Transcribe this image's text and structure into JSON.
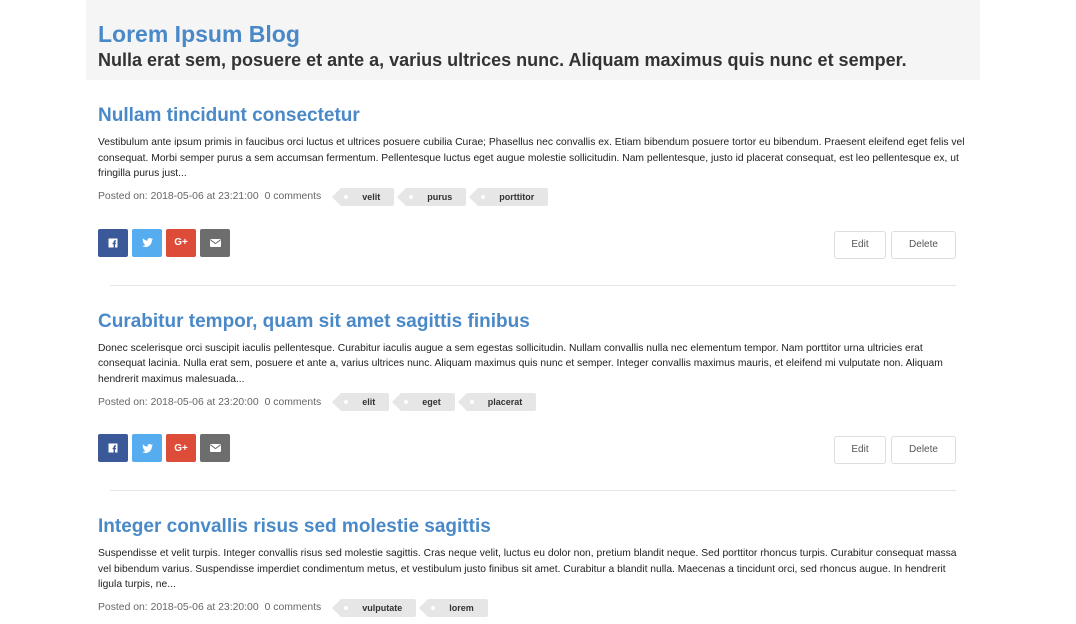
{
  "header": {
    "title": "Lorem Ipsum Blog",
    "subtitle": "Nulla erat sem, posuere et ante a, varius ultrices nunc. Aliquam maximus quis nunc et semper."
  },
  "posts": [
    {
      "title": "Nullam tincidunt consectetur",
      "excerpt": "Vestibulum ante ipsum primis in faucibus orci luctus et ultrices posuere cubilia Curae; Phasellus nec convallis ex. Etiam bibendum posuere tortor eu bibendum. Praesent eleifend eget felis vel consequat. Morbi semper purus a sem accumsan fermentum. Pellentesque luctus eget augue molestie sollicitudin. Nam pellentesque, justo id placerat consequat, est leo pellentesque ex, ut fringilla purus just...",
      "posted": "Posted on: 2018-05-06 at 23:21:00",
      "comments": "0 comments",
      "tags": [
        "velit",
        "purus",
        "porttitor"
      ],
      "edit_label": "Edit",
      "delete_label": "Delete"
    },
    {
      "title": "Curabitur tempor, quam sit amet sagittis finibus",
      "excerpt": "Donec scelerisque orci suscipit iaculis pellentesque. Curabitur iaculis augue a sem egestas sollicitudin. Nullam convallis nulla nec elementum tempor. Nam porttitor urna ultricies erat consequat lacinia. Nulla erat sem, posuere et ante a, varius ultrices nunc. Aliquam maximus quis nunc et semper. Integer convallis maximus mauris, et eleifend mi vulputate non. Aliquam hendrerit maximus malesuada...",
      "posted": "Posted on: 2018-05-06 at 23:20:00",
      "comments": "0 comments",
      "tags": [
        "elit",
        "eget",
        "placerat"
      ],
      "edit_label": "Edit",
      "delete_label": "Delete"
    },
    {
      "title": "Integer convallis risus sed molestie sagittis",
      "excerpt": "Suspendisse et velit turpis. Integer convallis risus sed molestie sagittis. Cras neque velit, luctus eu dolor non, pretium blandit neque. Sed porttitor rhoncus turpis. Curabitur consequat massa vel bibendum varius. Suspendisse imperdiet condimentum metus, et vestibulum justo finibus sit amet. Curabitur a blandit nulla. Maecenas a tincidunt orci, sed rhoncus augue. In hendrerit ligula turpis, ne...",
      "posted": "Posted on: 2018-05-06 at 23:20:00",
      "comments": "0 comments",
      "tags": [
        "vulputate",
        "lorem"
      ]
    }
  ],
  "share": {
    "facebook_icon": "facebook-icon",
    "twitter_icon": "twitter-icon",
    "google_plus_icon": "google-plus-icon",
    "google_plus_label": "G+",
    "email_icon": "envelope-icon"
  },
  "colors": {
    "accent": "#4a89c8",
    "facebook": "#3b5998",
    "twitter": "#55acee",
    "google_plus": "#dd4b39",
    "email": "#6d6d6d",
    "header_bg": "#f5f5f5",
    "tag_bg": "#e6e6e6"
  }
}
